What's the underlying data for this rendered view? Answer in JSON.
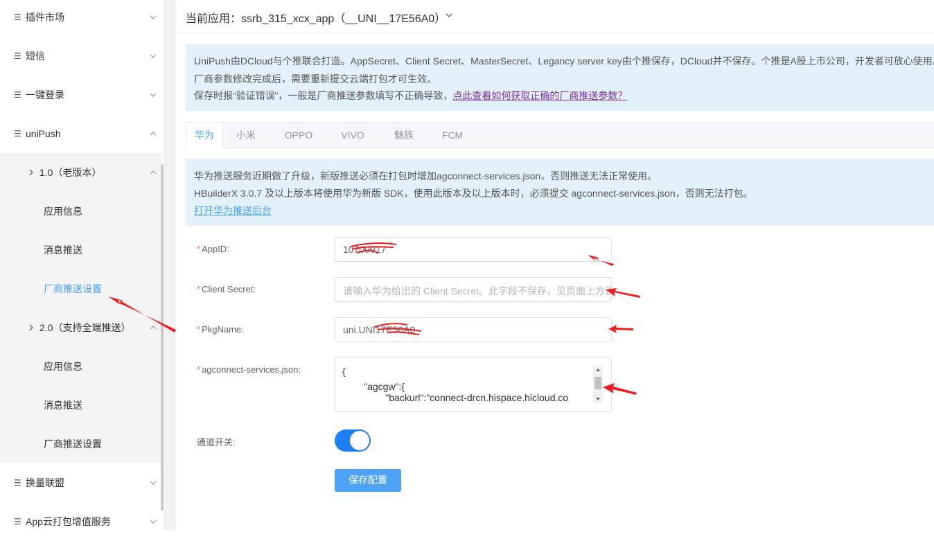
{
  "sidebar": {
    "top_items": [
      {
        "label": "插件市场",
        "expanded": false
      },
      {
        "label": "短信",
        "expanded": false
      },
      {
        "label": "一键登录",
        "expanded": false
      },
      {
        "label": "uniPush",
        "expanded": true
      }
    ],
    "groups": [
      {
        "label": "1.0（老版本）",
        "items": [
          "应用信息",
          "消息推送",
          "厂商推送设置"
        ]
      },
      {
        "label": "2.0（支持全端推送）",
        "items": [
          "应用信息",
          "消息推送",
          "厂商推送设置"
        ]
      }
    ],
    "bottom_items": [
      {
        "label": "换量联盟",
        "expanded": false
      },
      {
        "label": "App云打包增值服务",
        "expanded": false
      }
    ],
    "active_item": "厂商推送设置"
  },
  "header": {
    "label": "当前应用：ssrb_315_xcx_app（__UNI__17E56A0）"
  },
  "notice": {
    "line1": "UniPush由DCloud与个推联合打造。AppSecret、Client Secret、MasterSecret、Legancy server key由个推保存，DCloud并不保存。个推是A股上市公司，开发者可放心使用。",
    "line2": "厂商参数修改完成后，需要重新提交云端打包才可生效。",
    "line3_prefix": "保存时报“验证错误”，一般是厂商推送参数填写不正确导致，",
    "line3_link": "点此查看如何获取正确的厂商推送参数？"
  },
  "tabs": [
    "华为",
    "小米",
    "OPPO",
    "VIVO",
    "魅族",
    "FCM"
  ],
  "active_tab": "华为",
  "huawei_notice": {
    "line1": "华为推送服务近期做了升级，新版推送必须在打包时增加agconnect-services.json，否则推送无法正常使用。",
    "line2": "HBuilderX 3.0.7 及以上版本将使用华为新版 SDK，使用此版本及以上版本时，必须提交 agconnect-services.json，否则无法打包。",
    "link": "打开华为推送后台"
  },
  "form": {
    "required_mark": "*",
    "appid": {
      "label": "AppID:",
      "value": "10700017"
    },
    "client_secret": {
      "label": "Client Secret:",
      "placeholder": "请输入华为给出的 Client Secret。此字段不保存，见页面上方说明"
    },
    "pkgname": {
      "label": "PkgName:",
      "value": "uni.UNI17E56A0"
    },
    "agconnect": {
      "label": "agconnect-services.json:",
      "lines": [
        "{",
        "        \"agcgw\":{",
        "                \"backurl\":\"connect-drcn.hispace.hicloud.co"
      ]
    },
    "channel_switch": {
      "label": "通道开关:",
      "on": true
    },
    "save_label": "保存配置"
  },
  "colors": {
    "accent": "#409eff",
    "annotation": "#ee1c1c",
    "notice_bg": "#e3f2fa",
    "required": "#f56c6c"
  }
}
